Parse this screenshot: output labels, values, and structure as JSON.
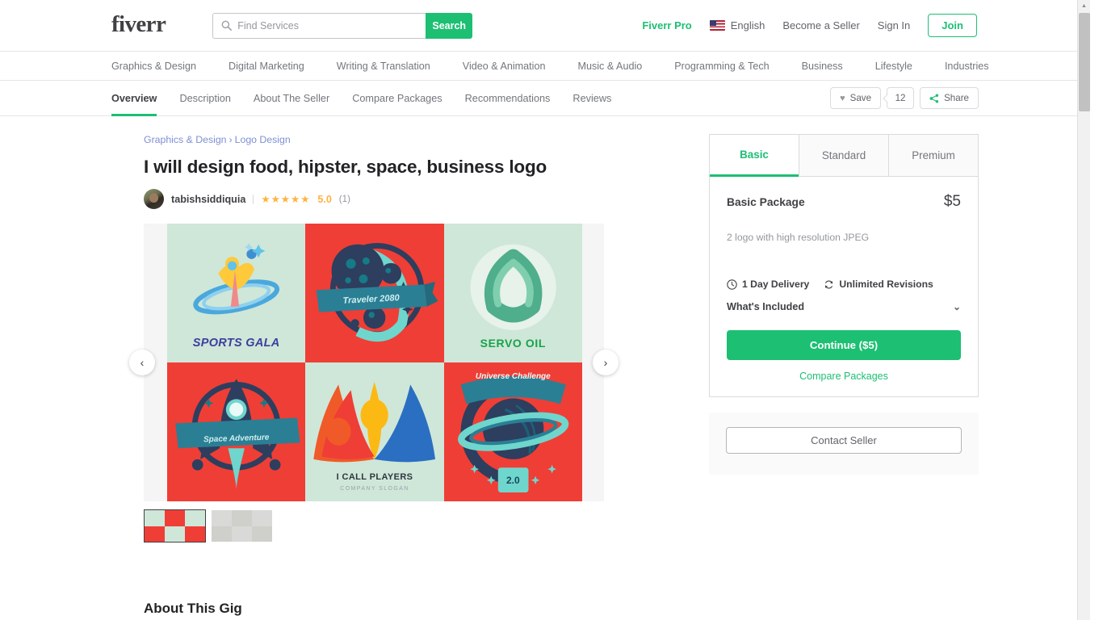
{
  "header": {
    "logo": "fiverr",
    "search": {
      "placeholder": "Find Services",
      "value": "",
      "button_label": "Search",
      "icon": "search-icon"
    },
    "pro_label": "Fiverr Pro",
    "language": "English",
    "become_seller": "Become a Seller",
    "sign_in": "Sign In",
    "join": "Join"
  },
  "categories": [
    "Graphics & Design",
    "Digital Marketing",
    "Writing & Translation",
    "Video & Animation",
    "Music & Audio",
    "Programming & Tech",
    "Business",
    "Lifestyle",
    "Industries"
  ],
  "gig_tabs": [
    {
      "label": "Overview",
      "active": true
    },
    {
      "label": "Description",
      "active": false
    },
    {
      "label": "About The Seller",
      "active": false
    },
    {
      "label": "Compare Packages",
      "active": false
    },
    {
      "label": "Recommendations",
      "active": false
    },
    {
      "label": "Reviews",
      "active": false
    }
  ],
  "tab_actions": {
    "save_label": "Save",
    "save_count": "12",
    "share_label": "Share"
  },
  "breadcrumb": {
    "parent": "Graphics & Design",
    "separator": "›",
    "child": "Logo Design"
  },
  "gig": {
    "title": "I will design food, hipster, space, business logo",
    "seller": "tabishsiddiquia",
    "stars": "★★★★★",
    "rating": "5.0",
    "reviews": "(1)",
    "about_heading": "About This Gig"
  },
  "gallery": {
    "prev": "‹",
    "next": "›",
    "tiles": [
      {
        "name": "sports-gala-logo",
        "label": "SPORTS GALA",
        "bg": "mint"
      },
      {
        "name": "traveler-2080-logo",
        "label": "Traveler 2080",
        "bg": "red"
      },
      {
        "name": "servo-oil-logo",
        "label": "SERVO OIL",
        "bg": "mint"
      },
      {
        "name": "space-adventure-logo",
        "label": "Space Adventure",
        "bg": "red"
      },
      {
        "name": "i-call-players-logo",
        "label": "I CALL PLAYERS",
        "sublabel": "COMPANY SLOGAN",
        "bg": "mint"
      },
      {
        "name": "universe-challenge-logo",
        "label": "Universe Challenge",
        "sublabel": "2.0",
        "bg": "red"
      }
    ]
  },
  "package": {
    "tabs": [
      {
        "label": "Basic",
        "active": true
      },
      {
        "label": "Standard",
        "active": false
      },
      {
        "label": "Premium",
        "active": false
      }
    ],
    "name": "Basic Package",
    "price": "$5",
    "description": "2 logo with high resolution JPEG",
    "delivery": "1 Day Delivery",
    "revisions": "Unlimited Revisions",
    "whats_included": "What's Included",
    "chevron": "⌄",
    "continue_label": "Continue ($5)",
    "compare_label": "Compare Packages",
    "contact_label": "Contact Seller"
  },
  "colors": {
    "brand_green": "#1dbf73",
    "text_dark": "#404145",
    "text_muted": "#74767e",
    "star_yellow": "#ffb33e",
    "tile_red": "#ef3e36",
    "tile_mint": "#cfe7d8"
  }
}
